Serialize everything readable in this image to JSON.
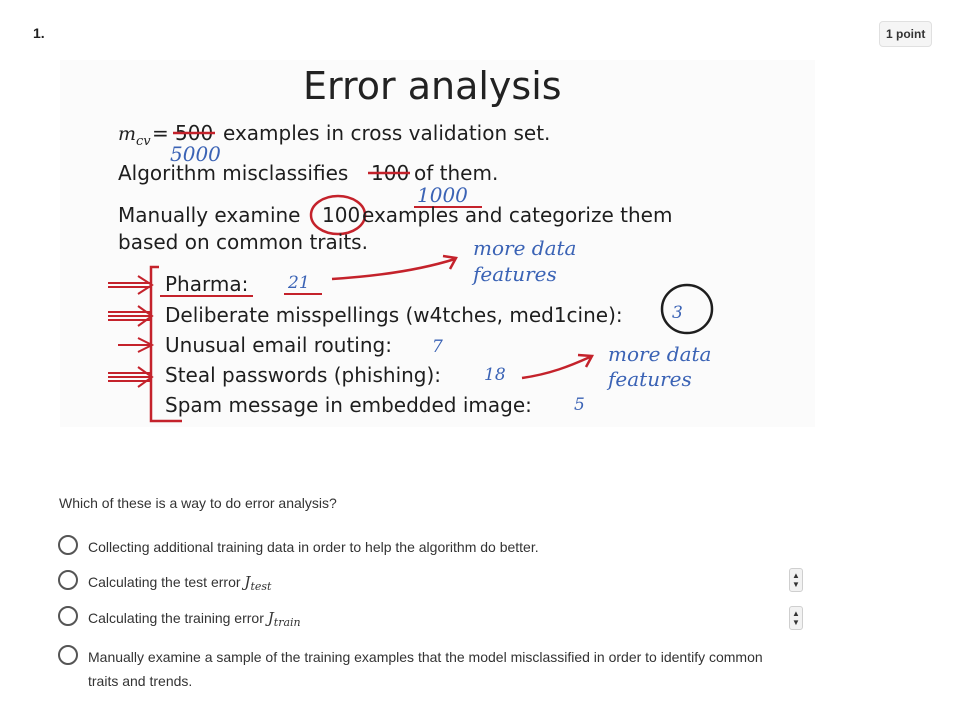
{
  "question": {
    "number": "1.",
    "points": "1 point",
    "prompt": "Which of these is a way to do error analysis?"
  },
  "figure": {
    "title": "Error analysis",
    "line1_math": "m",
    "line1_math_sub": "cv",
    "line1_eq": "=",
    "line1_struck": "500",
    "line1_rest": "examples in cross validation set.",
    "line1_hand": "5000",
    "line2_pre": "Algorithm misclassifies",
    "line2_struck": "100",
    "line2_rest": "of them.",
    "line2_hand": "1000",
    "line3_pre": "Manually examine",
    "line3_circled": "100",
    "line3_rest": "examples and categorize them",
    "line4": "based on common traits.",
    "note1_a": "more data",
    "note1_b": "features",
    "note2_a": "more data",
    "note2_b": "features",
    "categories": [
      {
        "label": "Pharma:",
        "count": "21"
      },
      {
        "label": "Deliberate misspellings (w4tches, med1cine):",
        "count": "3"
      },
      {
        "label": "Unusual email routing:",
        "count": "7"
      },
      {
        "label": "Steal passwords (phishing):",
        "count": "18"
      },
      {
        "label": "Spam message in embedded image:",
        "count": "5"
      }
    ],
    "colors": {
      "ink": "#c4222b",
      "hand": "#3b63b5"
    }
  },
  "options": [
    {
      "label": "Collecting additional training data in order to help the algorithm do better."
    },
    {
      "label": "Calculating the test error",
      "math": "J",
      "math_sub": "test"
    },
    {
      "label": "Calculating the training error",
      "math": "J",
      "math_sub": "train"
    },
    {
      "label": "Manually examine a sample of the training examples that the model misclassified in order to identify common traits and trends."
    }
  ],
  "spinner_icons": {
    "up": "▲",
    "down": "▼"
  }
}
